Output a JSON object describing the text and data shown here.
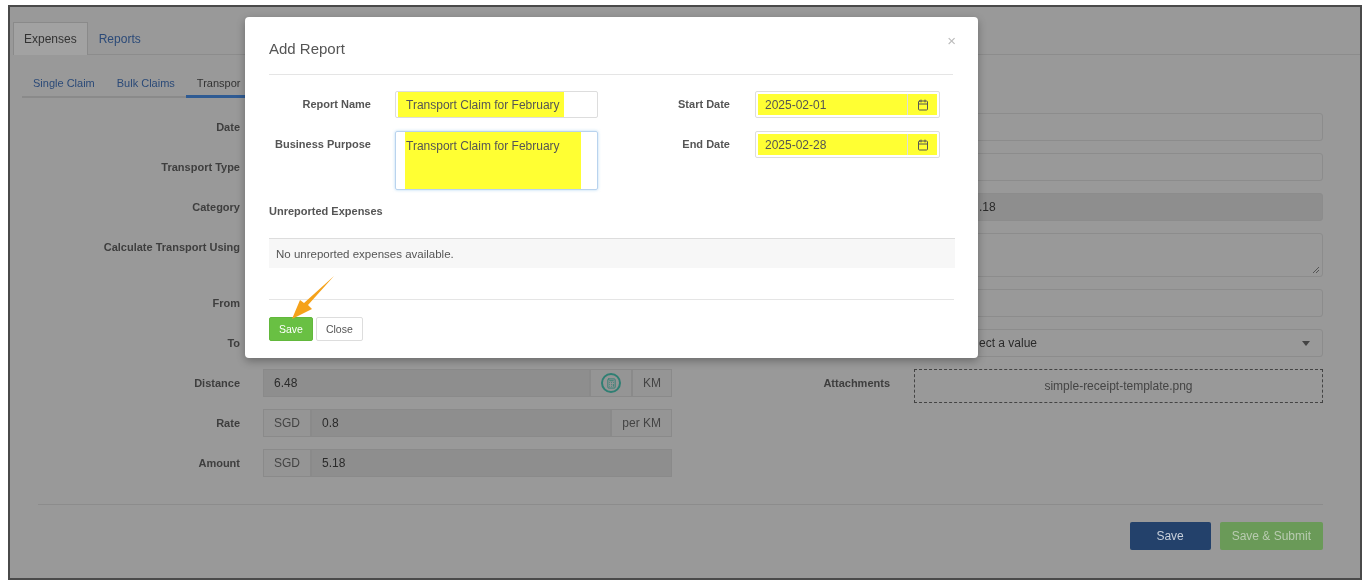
{
  "tabs": [
    {
      "label": "Expenses",
      "selected": true
    },
    {
      "label": "Reports",
      "selected": false
    }
  ],
  "subtabs": [
    {
      "label": "Single Claim",
      "selected": false
    },
    {
      "label": "Bulk Claims",
      "selected": false
    },
    {
      "label": "Transpor",
      "selected": true
    }
  ],
  "left_rows": [
    {
      "label": "Date",
      "kind": "covered"
    },
    {
      "label": "Transport Type",
      "kind": "covered"
    },
    {
      "label": "Category",
      "kind": "covered"
    },
    {
      "label": "Calculate Transport Using",
      "kind": "covered"
    },
    {
      "label": "From",
      "kind": "covered"
    },
    {
      "label": "To",
      "kind": "covered"
    },
    {
      "label": "Distance",
      "kind": "calc",
      "value": "6.48",
      "suffix": "KM"
    },
    {
      "label": "Rate",
      "kind": "affix",
      "prefix": "SGD",
      "value": "0.8",
      "suffix": "per KM"
    },
    {
      "label": "Amount",
      "kind": "affix",
      "prefix": "SGD",
      "value": "5.18"
    }
  ],
  "right_rows": [
    {
      "kind": "input"
    },
    {
      "kind": "input"
    },
    {
      "kind": "readonly",
      "value": ".18"
    },
    {
      "kind": "textarea"
    },
    {
      "kind": "input"
    },
    {
      "kind": "select",
      "value": "ect a value"
    },
    {
      "kind": "attachment",
      "label": "Attachments",
      "file": "simple-receipt-template.png"
    }
  ],
  "buttons": [
    {
      "label": "Save",
      "kind": "primary"
    },
    {
      "label": "Save & Submit",
      "kind": "success"
    }
  ],
  "modal": {
    "title": "Add Report",
    "close": "×",
    "fields": [
      {
        "label": "Report Name",
        "kind": "text",
        "value": "Transport Claim for February"
      },
      {
        "label": "Start Date",
        "kind": "date",
        "value": "2025-02-01"
      },
      {
        "label": "Business Purpose",
        "kind": "textarea",
        "value": "Transport Claim for February"
      },
      {
        "label": "End Date",
        "kind": "date",
        "value": "2025-02-28"
      }
    ],
    "section": "Unreported Expenses",
    "empty_message": "No unreported expenses available.",
    "buttons": [
      {
        "label": "Save",
        "kind": "success"
      },
      {
        "label": "Close",
        "kind": "default"
      }
    ]
  }
}
